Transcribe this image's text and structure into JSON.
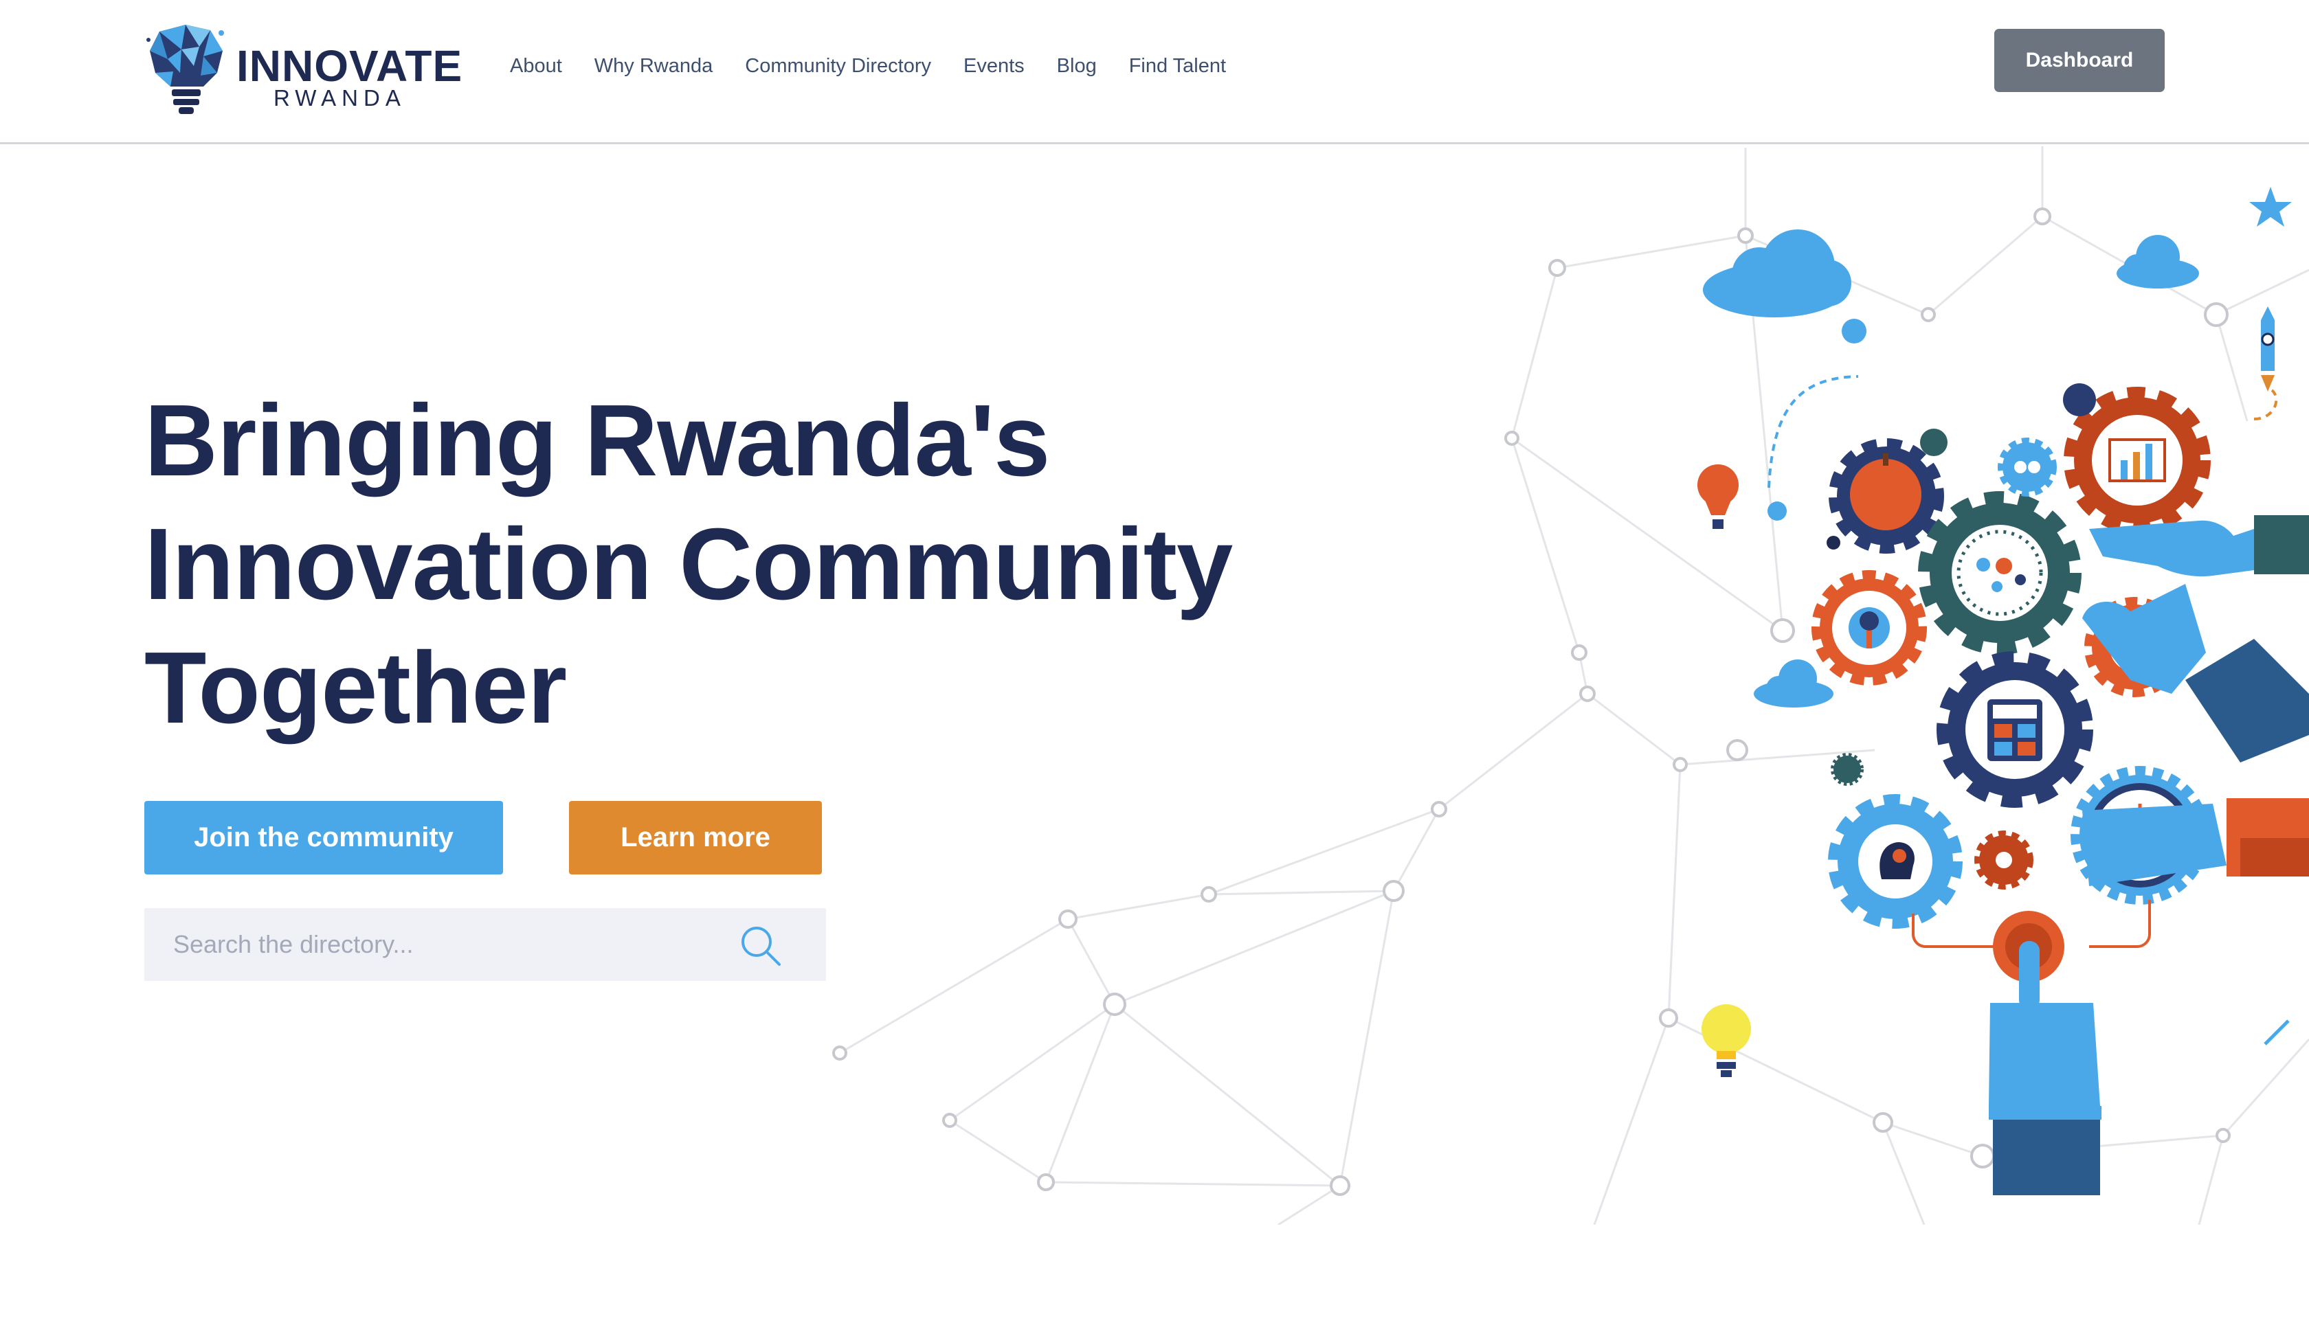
{
  "brand": {
    "name": "INNOVATE",
    "sub": "RWANDA"
  },
  "nav": {
    "items": [
      {
        "label": "About"
      },
      {
        "label": "Why Rwanda"
      },
      {
        "label": "Community Directory"
      },
      {
        "label": "Events"
      },
      {
        "label": "Blog"
      },
      {
        "label": "Find Talent"
      }
    ]
  },
  "header": {
    "dashboard_label": "Dashboard"
  },
  "hero": {
    "headline_lines": [
      "Bringing Rwanda's",
      "Innovation Community",
      "Together"
    ],
    "join_label": "Join the community",
    "learn_label": "Learn more",
    "search_placeholder": "Search the directory..."
  },
  "colors": {
    "navy": "#1e2a52",
    "blue": "#4aa8e8",
    "orange": "#e08a30",
    "dashboard_gray": "#6c7480",
    "search_bg": "#eff1f6"
  },
  "icons": [
    "lightbulb-logo-icon",
    "search-icon",
    "gear-icon",
    "cloud-icon",
    "hand-icon",
    "clock-icon",
    "calculator-icon",
    "rocket-icon",
    "balloon-icon",
    "star-icon"
  ]
}
